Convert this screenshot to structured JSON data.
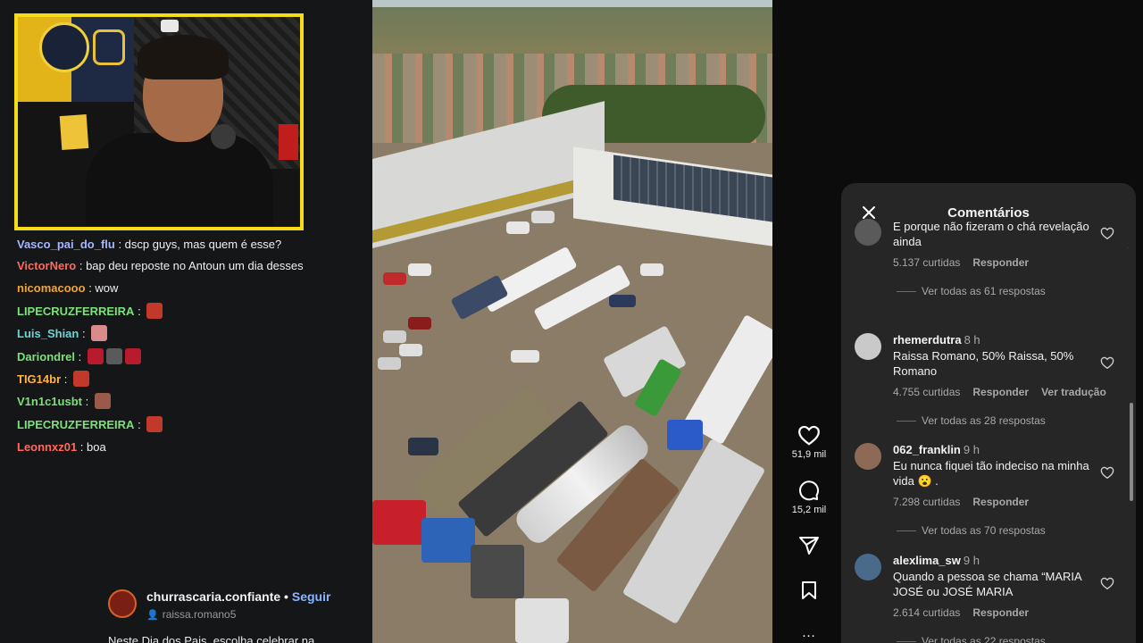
{
  "chat": {
    "messages": [
      {
        "user": "Vasco_pai_do_flu",
        "color": "#a4b7ff",
        "text": "dscp guys, mas quem é esse?",
        "emotes": []
      },
      {
        "user": "VictorNero",
        "color": "#ff6a5c",
        "text": "bap deu reposte no Antoun um dia desses",
        "emotes": []
      },
      {
        "user": "nicomacooo",
        "color": "#f0a63a",
        "text": "wow",
        "emotes": []
      },
      {
        "user": "LIPECRUZFERREIRA",
        "color": "#7ee07a",
        "text": "",
        "emotes": [
          "#c0392b"
        ]
      },
      {
        "user": "Luis_Shian",
        "color": "#6fd3d3",
        "text": "",
        "emotes": [
          "#d98b8b"
        ]
      },
      {
        "user": "Dariondrel",
        "color": "#7ee07a",
        "text": "",
        "emotes": [
          "#b81b2c",
          "#5a5a5a",
          "#b81b2c"
        ]
      },
      {
        "user": "TIG14br",
        "color": "#ffb347",
        "text": "",
        "emotes": [
          "#c0392b"
        ]
      },
      {
        "user": "V1n1c1usbt",
        "color": "#7ee07a",
        "text": "",
        "emotes": [
          "#9a5a4a"
        ]
      },
      {
        "user": "LIPECRUZFERREIRA",
        "color": "#7ee07a",
        "text": "",
        "emotes": [
          "#c0392b"
        ]
      },
      {
        "user": "Leonnxz01",
        "color": "#ff6a5c",
        "text": "boa",
        "emotes": []
      }
    ]
  },
  "post_author": {
    "name": "churrascaria.confiante",
    "separator": " • ",
    "follow_label": "Seguir",
    "audio_label": "raissa.romano5",
    "caption": "Neste Dia dos Pais, escolha celebrar na"
  },
  "actions": {
    "likes": "51,9 mil",
    "comments": "15,2 mil",
    "more": "…"
  },
  "comments_panel": {
    "title": "Comentários",
    "items": [
      {
        "user": "",
        "time": "",
        "text": "E porque não fizeram o chá revelação ainda",
        "likes": "5.137 curtidas",
        "reply": "Responder",
        "translate": "",
        "replies": "Ver todas as 61 respostas",
        "avatar_color": "#5a5a5a"
      },
      {
        "user": "rhemerdutra",
        "time": "8 h",
        "text": "Raissa Romano, 50% Raissa, 50% Romano",
        "likes": "4.755 curtidas",
        "reply": "Responder",
        "translate": "Ver tradução",
        "replies": "Ver todas as 28 respostas",
        "avatar_color": "#c9c9c9"
      },
      {
        "user": "062_franklin",
        "time": "9 h",
        "text": "Eu nunca fiquei tão indeciso na minha vida 😮 .",
        "likes": "7.298 curtidas",
        "reply": "Responder",
        "translate": "",
        "replies": "Ver todas as 70 respostas",
        "avatar_color": "#8c6a55"
      },
      {
        "user": "alexlima_sw",
        "time": "9 h",
        "text": "Quando a pessoa se chama “MARIA JOSÉ ou JOSÉ MARIA",
        "likes": "2.614 curtidas",
        "reply": "Responder",
        "translate": "",
        "replies": "Ver todas as 22 respostas",
        "avatar_color": "#4a6a8c"
      }
    ]
  }
}
